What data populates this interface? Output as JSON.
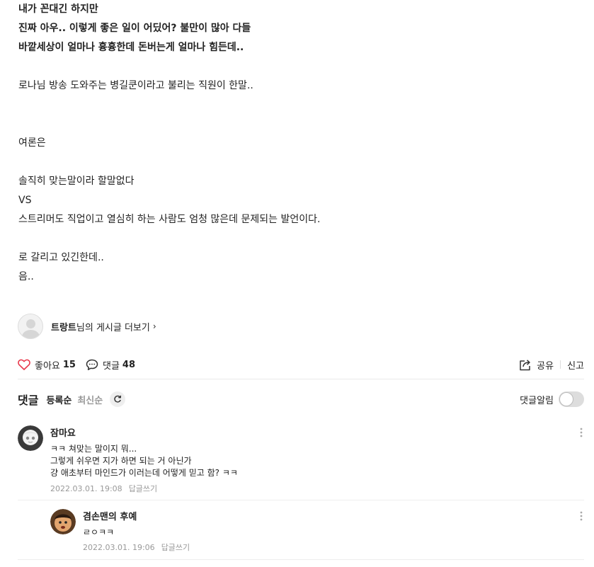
{
  "post": {
    "lines": [
      {
        "text": "내가 꼰대긴 하지만",
        "bold": true
      },
      {
        "text": "진짜 아우.. 이렇게 좋은 일이 어딨어? 불만이 많아 다들",
        "bold": true
      },
      {
        "text": "바깥세상이 얼마나 흉흉한데 돈버는게 얼마나 힘든데..",
        "bold": true
      },
      {
        "text": "",
        "bold": false
      },
      {
        "text": "로나님 방송 도와주는 병길쿤이라고 불리는 직원이 한말..",
        "bold": false
      },
      {
        "text": "",
        "bold": false
      },
      {
        "text": "",
        "bold": false
      },
      {
        "text": "여론은",
        "bold": false
      },
      {
        "text": "",
        "bold": false
      },
      {
        "text": "솔직히 맞는말이라 할말없다",
        "bold": false
      },
      {
        "text": "VS",
        "bold": false
      },
      {
        "text": "스트리머도 직업이고 열심히 하는 사람도 엄청 많은데 문제되는 발언이다.",
        "bold": false
      },
      {
        "text": "",
        "bold": false
      },
      {
        "text": "로 갈리고 있긴한데..",
        "bold": false
      },
      {
        "text": "음..",
        "bold": false
      }
    ]
  },
  "author": {
    "nickname": "트랑트",
    "suffix": "님의 게시글 더보기",
    "chevron": "›"
  },
  "actions": {
    "like_label": "좋아요",
    "like_count": "15",
    "comment_label": "댓글",
    "comment_count": "48",
    "share_label": "공유",
    "report_label": "신고"
  },
  "comments_section": {
    "title": "댓글",
    "sort_registered": "등록순",
    "sort_latest": "최신순",
    "notify_label": "댓글알림"
  },
  "comments": [
    {
      "nickname": "잠마요",
      "lines": [
        "ㅋㅋ 쳐맞는 말이지 뭐...",
        "그렇게 쉬우면 지가 하면 되는 거 아닌가",
        "걍 애초부터 마인드가 이러는데 어떻게 믿고 함? ㅋㅋ"
      ],
      "date": "2022.03.01. 19:08",
      "reply_label": "답글쓰기"
    },
    {
      "nickname": "겸손맨의 후예",
      "lines": [
        "ㄹㅇㅋㅋ"
      ],
      "date": "2022.03.01. 19:06",
      "reply_label": "답글쓰기"
    }
  ],
  "icons": {
    "like": "heart-outline-icon",
    "comment": "speech-bubble-icon",
    "share": "share-icon",
    "refresh": "refresh-icon",
    "more": "vertical-dots-icon"
  },
  "colors": {
    "like_red": "#e8364a",
    "muted": "#999999",
    "text": "#222222"
  }
}
